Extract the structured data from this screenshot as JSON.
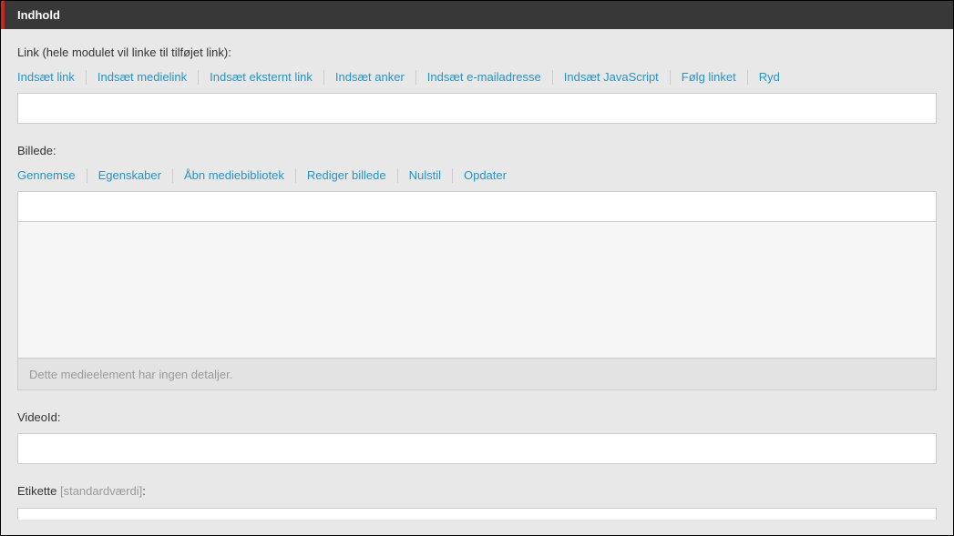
{
  "header": {
    "title": "Indhold"
  },
  "linkSection": {
    "label": "Link (hele modulet vil linke til tilføjet link):",
    "buttons": [
      "Indsæt link",
      "Indsæt medielink",
      "Indsæt eksternt link",
      "Indsæt anker",
      "Indsæt e-mailadresse",
      "Indsæt JavaScript",
      "Følg linket",
      "Ryd"
    ],
    "value": ""
  },
  "imageSection": {
    "label": "Billede:",
    "buttons": [
      "Gennemse",
      "Egenskaber",
      "Åbn mediebibliotek",
      "Rediger billede",
      "Nulstil",
      "Opdater"
    ],
    "value": "",
    "detailsText": "Dette medieelement har ingen detaljer."
  },
  "videoSection": {
    "label": "VideoId:",
    "value": ""
  },
  "etiketteSection": {
    "label": "Etikette ",
    "hint": "[standardværdi]",
    "colon": ":"
  }
}
